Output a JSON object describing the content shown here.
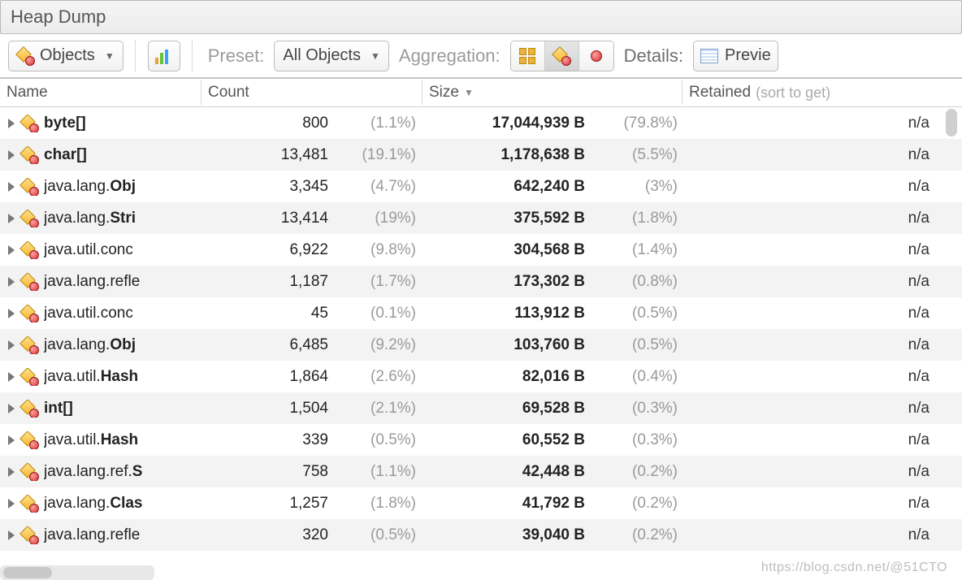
{
  "window": {
    "title": "Heap Dump"
  },
  "toolbar": {
    "objects_label": "Objects",
    "preset_label": "Preset:",
    "preset_value": "All Objects",
    "aggregation_label": "Aggregation:",
    "details_label": "Details:",
    "preview_label": "Previe"
  },
  "columns": {
    "name": "Name",
    "count": "Count",
    "size": "Size",
    "retained": "Retained",
    "retained_hint": "(sort to get)"
  },
  "rows": [
    {
      "name_prefix": "",
      "name_bold": "byte[]",
      "count": "800",
      "count_pct": "(1.1%)",
      "size": "17,044,939 B",
      "size_pct": "(79.8%)",
      "retained": "n/a"
    },
    {
      "name_prefix": "",
      "name_bold": "char[]",
      "count": "13,481",
      "count_pct": "(19.1%)",
      "size": "1,178,638 B",
      "size_pct": "(5.5%)",
      "retained": "n/a"
    },
    {
      "name_prefix": "java.lang.",
      "name_bold": "Obj",
      "count": "3,345",
      "count_pct": "(4.7%)",
      "size": "642,240 B",
      "size_pct": "(3%)",
      "retained": "n/a"
    },
    {
      "name_prefix": "java.lang.",
      "name_bold": "Stri",
      "count": "13,414",
      "count_pct": "(19%)",
      "size": "375,592 B",
      "size_pct": "(1.8%)",
      "retained": "n/a"
    },
    {
      "name_prefix": "java.util.conc",
      "name_bold": "",
      "count": "6,922",
      "count_pct": "(9.8%)",
      "size": "304,568 B",
      "size_pct": "(1.4%)",
      "retained": "n/a"
    },
    {
      "name_prefix": "java.lang.refle",
      "name_bold": "",
      "count": "1,187",
      "count_pct": "(1.7%)",
      "size": "173,302 B",
      "size_pct": "(0.8%)",
      "retained": "n/a"
    },
    {
      "name_prefix": "java.util.conc",
      "name_bold": "",
      "count": "45",
      "count_pct": "(0.1%)",
      "size": "113,912 B",
      "size_pct": "(0.5%)",
      "retained": "n/a"
    },
    {
      "name_prefix": "java.lang.",
      "name_bold": "Obj",
      "count": "6,485",
      "count_pct": "(9.2%)",
      "size": "103,760 B",
      "size_pct": "(0.5%)",
      "retained": "n/a"
    },
    {
      "name_prefix": "java.util.",
      "name_bold": "Hash",
      "count": "1,864",
      "count_pct": "(2.6%)",
      "size": "82,016 B",
      "size_pct": "(0.4%)",
      "retained": "n/a"
    },
    {
      "name_prefix": "",
      "name_bold": "int[]",
      "count": "1,504",
      "count_pct": "(2.1%)",
      "size": "69,528 B",
      "size_pct": "(0.3%)",
      "retained": "n/a"
    },
    {
      "name_prefix": "java.util.",
      "name_bold": "Hash",
      "count": "339",
      "count_pct": "(0.5%)",
      "size": "60,552 B",
      "size_pct": "(0.3%)",
      "retained": "n/a"
    },
    {
      "name_prefix": "java.lang.ref.",
      "name_bold": "S",
      "count": "758",
      "count_pct": "(1.1%)",
      "size": "42,448 B",
      "size_pct": "(0.2%)",
      "retained": "n/a"
    },
    {
      "name_prefix": "java.lang.",
      "name_bold": "Clas",
      "count": "1,257",
      "count_pct": "(1.8%)",
      "size": "41,792 B",
      "size_pct": "(0.2%)",
      "retained": "n/a"
    },
    {
      "name_prefix": "java.lang.refle",
      "name_bold": "",
      "count": "320",
      "count_pct": "(0.5%)",
      "size": "39,040 B",
      "size_pct": "(0.2%)",
      "retained": "n/a"
    }
  ],
  "watermark": "https://blog.csdn.net/@51CTO"
}
